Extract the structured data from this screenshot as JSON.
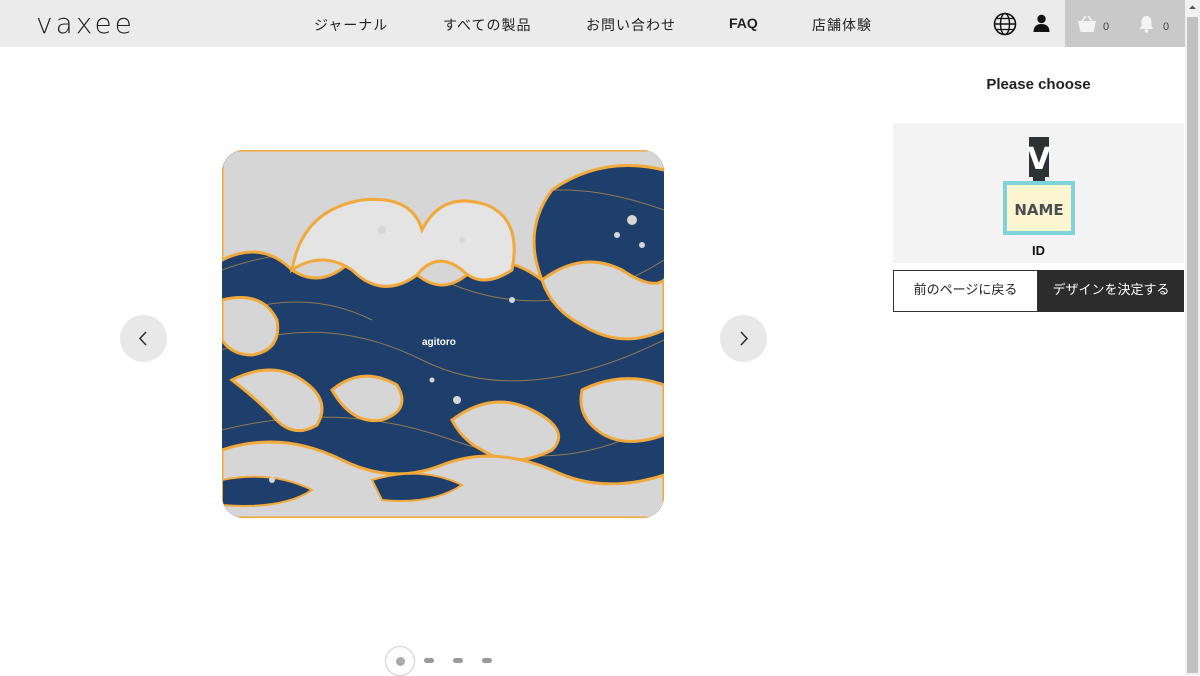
{
  "header": {
    "logo_text": "vaxee",
    "nav": [
      {
        "label": "ジャーナル"
      },
      {
        "label": "すべての製品"
      },
      {
        "label": "お問い合わせ"
      },
      {
        "label": "FAQ"
      },
      {
        "label": "店舗体験"
      }
    ],
    "cart_count": "0",
    "notification_count": "0",
    "icons": [
      "globe-icon",
      "user-icon",
      "cart-icon",
      "bell-icon"
    ]
  },
  "product": {
    "mousepad_brand": "agitoro",
    "mousepad_maker": "vaxee",
    "carousel": {
      "slide_count": 4,
      "active_index": 0,
      "prev_icon": "chevron-left-icon",
      "next_icon": "chevron-right-icon"
    }
  },
  "sidebar": {
    "title": "Please choose",
    "option": {
      "badge_text": "NAME",
      "badge_letter": "V",
      "label": "ID"
    },
    "back_label": "前のページに戻る",
    "confirm_label": "デザインを決定する"
  },
  "colors": {
    "header_bg": "#ebebeb",
    "cart_bg": "#c9c9c9",
    "pad_blue": "#1e3e6c",
    "pad_gold": "#f2a93b",
    "pad_wave": "#d6d6d6",
    "confirm_bg": "#2c2c2c",
    "badge_border": "#7dd3d8",
    "badge_fill": "#fdf5cf"
  }
}
